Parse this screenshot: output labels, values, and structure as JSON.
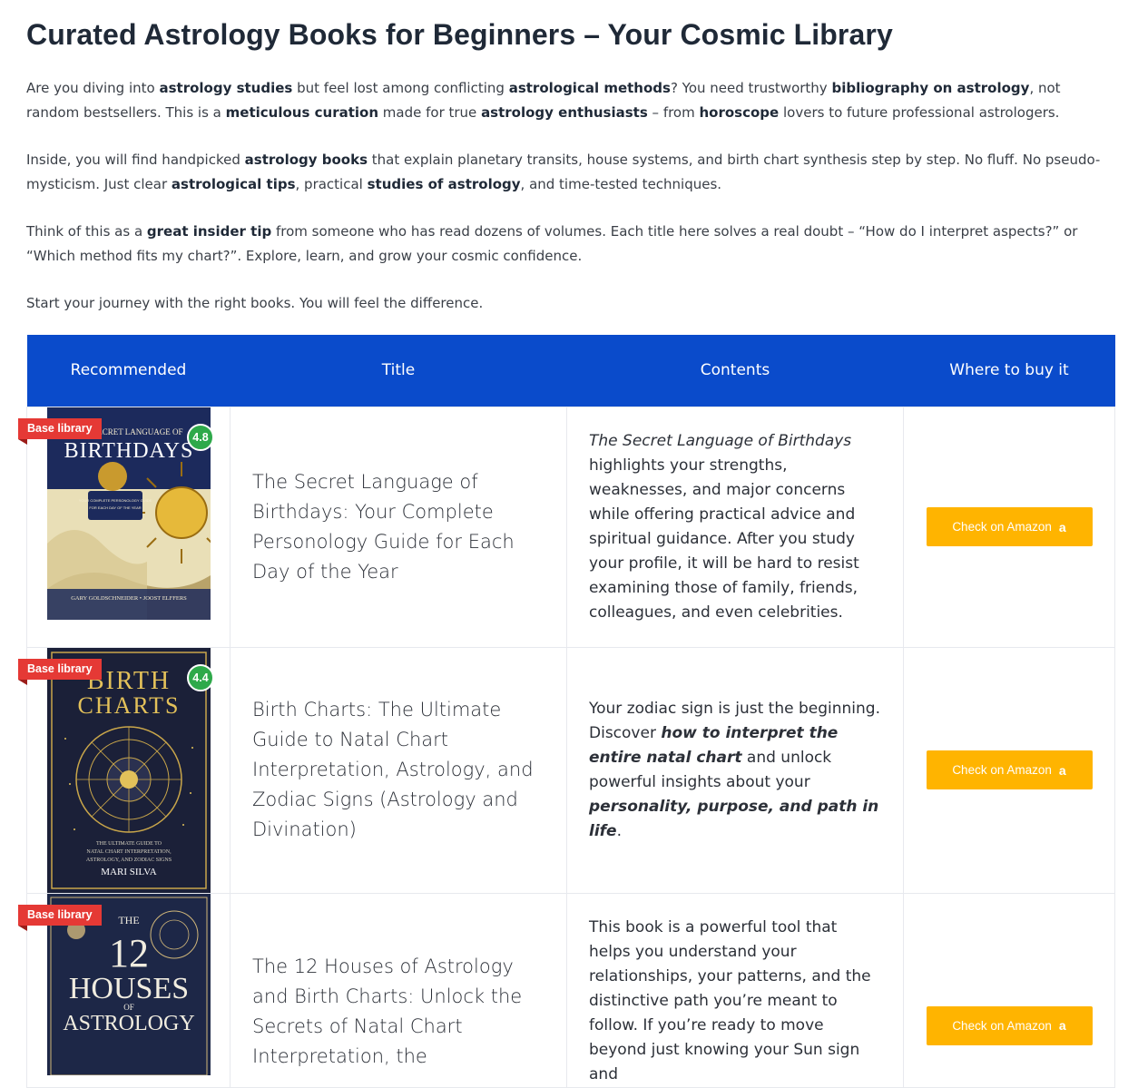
{
  "heading": "Curated Astrology Books for Beginners – Your Cosmic Library",
  "intro": [
    [
      {
        "t": "Are you diving into "
      },
      {
        "b": "astrology studies"
      },
      {
        "t": " but feel lost among conflicting "
      },
      {
        "b": "astrological methods"
      },
      {
        "t": "? You need trustworthy "
      },
      {
        "b": "bibliography on astrology"
      },
      {
        "t": ", not random bestsellers. This is a "
      },
      {
        "b": "meticulous curation"
      },
      {
        "t": " made for true "
      },
      {
        "b": "astrology enthusiasts"
      },
      {
        "t": " – from "
      },
      {
        "b": "horoscope"
      },
      {
        "t": " lovers to future professional astrologers."
      }
    ],
    [
      {
        "t": "Inside, you will find handpicked "
      },
      {
        "b": "astrology books"
      },
      {
        "t": " that explain planetary transits, house systems, and birth chart synthesis step by step. No fluff. No pseudo-mysticism. Just clear "
      },
      {
        "b": "astrological tips"
      },
      {
        "t": ", practical "
      },
      {
        "b": "studies of astrology"
      },
      {
        "t": ", and time-tested techniques."
      }
    ],
    [
      {
        "t": "Think of this as a "
      },
      {
        "b": "great insider tip"
      },
      {
        "t": " from someone who has read dozens of volumes. Each title here solves a real doubt – “How do I interpret aspects?” or “Which method fits my chart?”. Explore, learn, and grow your cosmic confidence."
      }
    ],
    [
      {
        "t": "Start your journey with the right books. You will feel the difference."
      }
    ]
  ],
  "table": {
    "headers": {
      "recommended": "Recommended",
      "title": "Title",
      "contents": "Contents",
      "buy": "Where to buy it"
    },
    "rows": [
      {
        "badge": "Base library",
        "rating": "4.8",
        "cover": {
          "top": "THE SECRET LANGUAGE OF",
          "main": "BIRTHDAYS",
          "sub": "YOUR COMPLETE PERSONOLOGY GUIDE FOR EACH DAY OF THE YEAR",
          "authors": "GARY GOLDSCHNEIDER • JOOST ELFFERS"
        },
        "title": "The Secret Language of Birthdays: Your Complete Personology Guide for Each Day of the Year",
        "contents": [
          {
            "i": "The Secret Language of Birthdays"
          },
          {
            "t": " highlights your strengths, weaknesses, and major concerns while offering practical advice and spiritual guidance. After you study your profile, it will be hard to resist examining those of family, friends, colleagues, and even celebrities."
          }
        ],
        "button": "Check on Amazon"
      },
      {
        "badge": "Base library",
        "rating": "4.4",
        "cover": {
          "main1": "BIRTH",
          "main2": "CHARTS",
          "sub": "THE ULTIMATE GUIDE TO NATAL CHART INTERPRETATION, ASTROLOGY, AND ZODIAC SIGNS",
          "authors": "MARI SILVA"
        },
        "title": "Birth Charts: The Ultimate Guide to Natal Chart Interpretation, Astrology, and Zodiac Signs (Astrology and Divination)",
        "contents": [
          {
            "t": "Your zodiac sign is just the beginning. Discover "
          },
          {
            "bi": "how to interpret the entire natal chart"
          },
          {
            "t": " and unlock powerful insights about your "
          },
          {
            "bi": "personality, purpose, and path in life"
          },
          {
            "t": "."
          }
        ],
        "button": "Check on Amazon"
      },
      {
        "badge": "Base library",
        "cover": {
          "the": "THE",
          "num": "12",
          "main": "HOUSES",
          "of": "OF",
          "bottom": "ASTROLOGY"
        },
        "title": "The 12 Houses of Astrology and Birth Charts: Unlock the Secrets of Natal Chart Interpretation, the",
        "contents": [
          {
            "t": "This book is a powerful tool that helps you understand your relationships, your patterns, and the distinctive path you’re meant to follow. If you’re ready to move beyond just knowing your Sun sign and"
          }
        ],
        "button": "Check on Amazon"
      }
    ]
  },
  "colors": {
    "header_bg": "#0a4bcb",
    "badge": "#e53935",
    "rating": "#2ea94a",
    "amazon": "#ffb400"
  }
}
